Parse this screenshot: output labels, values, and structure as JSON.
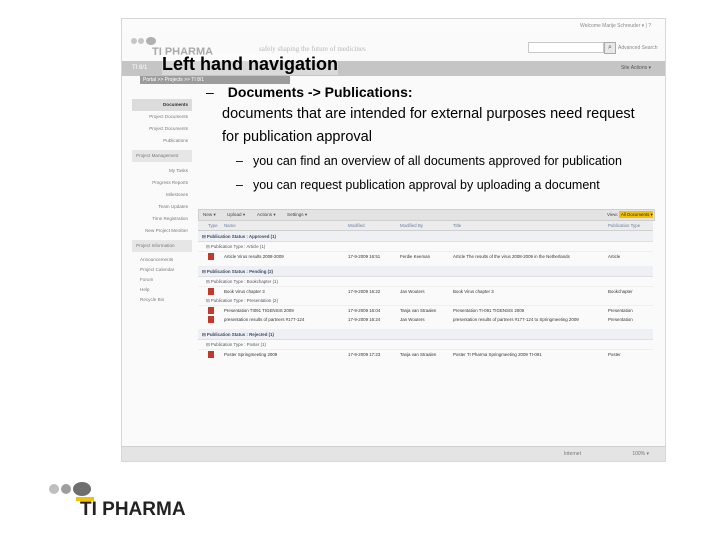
{
  "slide": {
    "title": "Left hand navigation",
    "bullet_main": {
      "dash": "–",
      "text": "Documents -> Publications:"
    },
    "sub_text_line1": "documents that are intended for external purposes need request",
    "sub_text_line2": "for publication approval",
    "sub_bullets": [
      {
        "dash": "–",
        "text": "you can find an overview of all documents approved for publication"
      },
      {
        "dash": "–",
        "text": "you can request publication approval by uploading a document"
      }
    ],
    "logo_text": "TI PHARMA"
  },
  "screenshot": {
    "user_menu": "Welcome Marije Schreuder ▾ | ?",
    "logo_text": "TI PHARMA",
    "tagline": "safely shaping the future of medicines",
    "advanced_search": "Advanced Search",
    "site_name": "TI 8/1",
    "site_actions": "Site Actions ▾",
    "breadcrumb": "Portal >> Projects >> TI 8/1",
    "nav": {
      "documents": "Documents",
      "items_top": [
        "Project Documents",
        "Project Documents",
        "Publications"
      ],
      "section1": "Project Management",
      "items_mid": [
        "My Tasks",
        "Progress Reports",
        "Milestones",
        "Team Updates",
        "Time Registration",
        "New Project Member"
      ],
      "section2": "Project Information",
      "items_bottom": [
        "Announcements",
        "Project Calendar",
        "Forum",
        "Help",
        "Recycle Bin"
      ]
    },
    "toolbar": {
      "new": "New ▾",
      "upload": "Upload ▾",
      "actions": "Actions ▾",
      "settings": "Settings ▾",
      "view_label": "View:",
      "view_value": "All Documents ▾"
    },
    "grid": {
      "headers": [
        "Type",
        "Name",
        "Modified",
        "Modified By",
        "Title",
        "Publication Type"
      ],
      "groups": [
        {
          "label": "⊟ Publication Status : Approved (1)",
          "subs": [
            {
              "label": "⊟ Publication Type : Article (1)",
              "rows": [
                [
                  "Article Virus results 2008-2009",
                  "17-9-2009 16:51",
                  "Ferdie Keeman",
                  "Article The results of the virus 2008-2009 in the Netherlands",
                  "Article"
                ]
              ]
            }
          ]
        },
        {
          "label": "⊟ Publication Status : Pending (2)",
          "subs": [
            {
              "label": "⊟ Publication Type : Bookchapter (1)",
              "rows": [
                [
                  "Book Virus chapter 3",
                  "17-9-2009 16:22",
                  "Jan Wouters",
                  "Book Virus chapter 3",
                  "Bookchapter"
                ]
              ]
            },
            {
              "label": "⊟ Publication Type : Presentation (2)",
              "rows": [
                [
                  "Presentation TI091 TIGENSIS 2009",
                  "17-9-2009 16:04",
                  "Tanja van Straalen",
                  "Presentation TI-091 TIGENSIS 2009",
                  "Presentation"
                ],
                [
                  "presentation results of partners #177-124",
                  "17-9-2009 16:24",
                  "Jan Wouters",
                  "presentation results of partners #177-124 to Springmeeting 2009",
                  "Presentation"
                ]
              ]
            }
          ]
        },
        {
          "label": "⊟ Publication Status : Rejected (1)",
          "subs": [
            {
              "label": "⊟ Publication Type : Poster (1)",
              "rows": [
                [
                  "Poster Springmeeting 2009",
                  "17-9-2009 17:23",
                  "Tanja van Straalen",
                  "Poster TI Pharma Springmeeting 2009 TI-091",
                  "Poster"
                ]
              ]
            }
          ]
        }
      ]
    },
    "statusbar": {
      "zone": "Internet",
      "zoom": "100% ▾"
    }
  }
}
